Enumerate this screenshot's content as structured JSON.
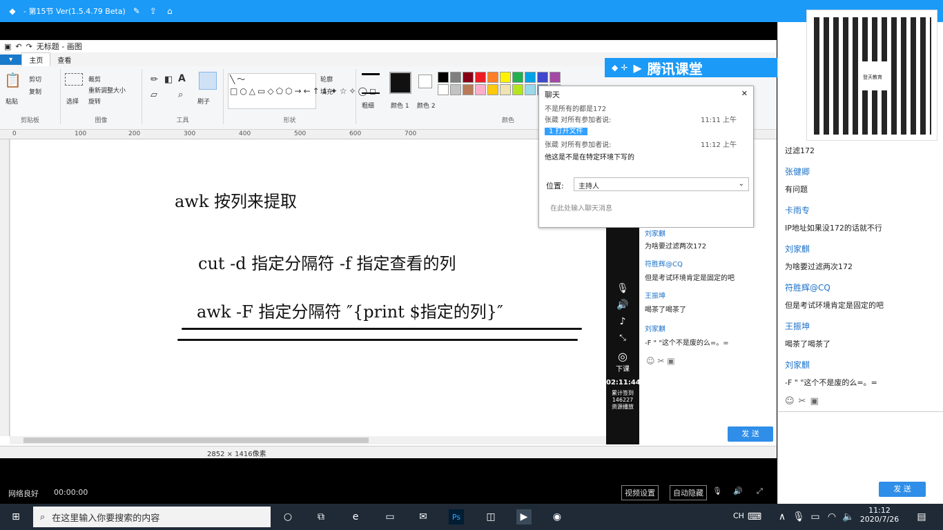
{
  "app_title": "- 第15节 Ver(1.5.4.79 Beta)",
  "paint": {
    "window_title": "无标题 - 画图",
    "tabs": [
      "",
      "主页",
      "查看"
    ],
    "groups": [
      "剪贴板",
      "图像",
      "工具",
      "形状",
      "颜色"
    ],
    "buttons": {
      "paste": "粘贴",
      "cut": "剪切",
      "copy": "复制",
      "select": "选择",
      "crop": "裁剪",
      "resize": "重新调整大小",
      "rotate": "旋转",
      "brush": "刷子",
      "outline": "轮廓",
      "fill": "填充",
      "size": "粗细",
      "color1": "颜色 1",
      "color2": "颜色 2"
    },
    "ruler_ticks": [
      "0",
      "100",
      "200",
      "300",
      "400",
      "500",
      "600",
      "700"
    ],
    "canvas_lines": [
      "awk    按列来提取",
      "cut  -d   指定分隔符  -f  指定查看的列",
      "awk   -F   指定分隔符   ″{print  $指定的列}″"
    ],
    "status_size": "2852 × 1416像素",
    "palette_colors": [
      "#000000",
      "#7f7f7f",
      "#880015",
      "#ed1c24",
      "#ff7f27",
      "#fff200",
      "#22b14c",
      "#00a2e8",
      "#3f48cc",
      "#a349a4",
      "#ffffff",
      "#c3c3c3",
      "#b97a57",
      "#ffaec9",
      "#ffc90e",
      "#efe4b0",
      "#b5e61d",
      "#99d9ea",
      "#7092be",
      "#c8bfe7"
    ]
  },
  "chat_popup": {
    "title": "聊天",
    "messages": [
      {
        "meta": "不是所有的都是172",
        "time": ""
      },
      {
        "meta": "张葳 对所有参加者说:",
        "time": "11:11 上午"
      },
      {
        "meta": "1 打开文件",
        "time": ""
      },
      {
        "meta": "张葳 对所有参加者说:",
        "time": "11:12 上午"
      },
      {
        "meta": "他这是不是在特定环境下写的",
        "time": ""
      }
    ],
    "position_label": "位置:",
    "position_value": "主持人",
    "input_placeholder": "在此处输入聊天消息"
  },
  "tencent": {
    "brand": "腾讯课堂",
    "class_label": "下课",
    "timer": "02:11:44",
    "stats": [
      "累计签到",
      "146227",
      "资源播放"
    ],
    "messages": [
      {
        "name": "刘家麒",
        "text": "为啥要过滤两次172"
      },
      {
        "name": "符胜辉@CQ",
        "text": "但是考试环境肯定是固定的吧"
      },
      {
        "name": "王振坤",
        "text": "喝茶了喝茶了"
      },
      {
        "name": "刘家麒",
        "text": "-F \" \"这个不是废的么=。="
      }
    ],
    "send_label": "发 送"
  },
  "right_panel": {
    "messages": [
      {
        "name": "",
        "text": "过滤172"
      },
      {
        "name": "张健卿",
        "text": "有问题"
      },
      {
        "name": "卡雨专",
        "text": "IP地址如果没172的话就不行"
      },
      {
        "name": "刘家麒",
        "text": "为啥要过滤两次172"
      },
      {
        "name": "符胜辉@CQ",
        "text": "但是考试环境肯定是固定的吧"
      },
      {
        "name": "王振坤",
        "text": "喝茶了喝茶了"
      },
      {
        "name": "刘家麒",
        "text": "-F \" \"这个不是废的么=。="
      }
    ],
    "qr_label": "登天教育",
    "send_label": "发 送"
  },
  "recbar": {
    "network": "网络良好",
    "time": "00:00:00",
    "buttons": [
      "视频设置",
      "自动隐藏"
    ]
  },
  "taskbar": {
    "search_placeholder": "在这里输入你要搜索的内容",
    "ime": "CH",
    "clock_time": "11:12",
    "clock_date": "2020/7/26"
  }
}
